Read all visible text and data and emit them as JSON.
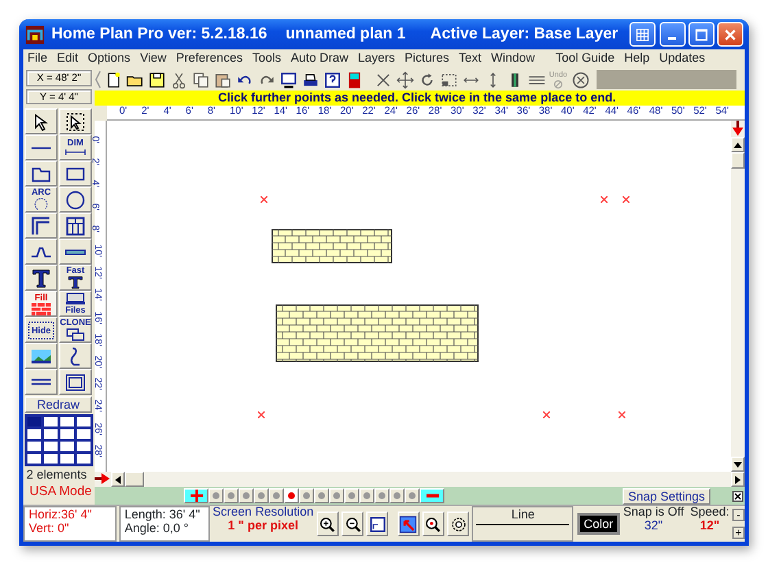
{
  "window": {
    "title": "Home Plan Pro ver: 5.2.18.16",
    "document": "unnamed plan 1",
    "layer": "Active Layer: Base Layer"
  },
  "menu": [
    "File",
    "Edit",
    "Options",
    "View",
    "Preferences",
    "Tools",
    "Auto Draw",
    "Layers",
    "Pictures",
    "Text",
    "Window",
    "Tool Guide",
    "Help",
    "Updates"
  ],
  "coordinates": {
    "x": "X = 48' 2\"",
    "y": "Y = 4' 4\""
  },
  "toolbar": [
    {
      "kind": "icon",
      "disabled": false
    },
    {
      "kind": "icon",
      "disabled": false
    },
    {
      "kind": "icon",
      "disabled": false
    },
    {
      "kind": "icon",
      "disabled": true
    },
    {
      "kind": "icon",
      "disabled": true
    },
    {
      "kind": "icon",
      "disabled": true
    },
    {
      "kind": "icon",
      "disabled": false
    },
    {
      "kind": "icon",
      "disabled": true
    },
    {
      "kind": "icon",
      "disabled": false
    },
    {
      "kind": "icon",
      "disabled": false
    },
    {
      "kind": "icon",
      "disabled": false
    },
    {
      "kind": "icon",
      "disabled": false
    },
    {
      "kind": "icon",
      "disabled": false
    },
    {
      "kind": "icon",
      "disabled": false
    },
    {
      "kind": "icon",
      "disabled": false
    },
    {
      "kind": "icon",
      "disabled": false
    },
    {
      "kind": "icon",
      "disabled": false
    },
    {
      "kind": "icon",
      "disabled": false
    },
    {
      "kind": "icon",
      "disabled": false
    },
    {
      "kind": "icon",
      "disabled": false
    },
    {
      "kind": "labeled",
      "label": "Undo",
      "disabled": true
    },
    {
      "kind": "icon",
      "disabled": false
    }
  ],
  "message": "Click further points as needed.  Click twice in the same place to end.",
  "ruler_x": [
    "0'",
    "2'",
    "4'",
    "6'",
    "8'",
    "10'",
    "12'",
    "14'",
    "16'",
    "18'",
    "20'",
    "22'",
    "24'",
    "26'",
    "28'",
    "30'",
    "32'",
    "34'",
    "36'",
    "38'",
    "40'",
    "42'",
    "44'",
    "46'",
    "48'",
    "50'",
    "52'",
    "54'"
  ],
  "ruler_y": [
    "0'",
    "2'",
    "4'",
    "6'",
    "8'",
    "10'",
    "12'",
    "14'",
    "16'",
    "18'",
    "20'",
    "22'",
    "24'",
    "26'",
    "28'"
  ],
  "tools": [
    {
      "kind": "icon"
    },
    {
      "kind": "icon"
    },
    {
      "kind": "icon"
    },
    {
      "kind": "labeled",
      "label": "DIM"
    },
    {
      "kind": "icon"
    },
    {
      "kind": "icon"
    },
    {
      "kind": "labeled",
      "label": "ARC"
    },
    {
      "kind": "icon"
    },
    {
      "kind": "icon"
    },
    {
      "kind": "icon"
    },
    {
      "kind": "icon"
    },
    {
      "kind": "icon"
    },
    {
      "kind": "icon"
    },
    {
      "kind": "labeled",
      "label": "Fast"
    },
    {
      "kind": "labeled",
      "label": "Fill"
    },
    {
      "kind": "labeled",
      "label": "Files"
    },
    {
      "kind": "labeled",
      "label": "Hide"
    },
    {
      "kind": "labeled",
      "label": "CLONE"
    },
    {
      "kind": "icon"
    },
    {
      "kind": "icon"
    },
    {
      "kind": "icon"
    },
    {
      "kind": "icon"
    }
  ],
  "redraw": "Redraw",
  "grid_cells": [
    {
      "selected": true
    },
    {
      "selected": false
    },
    {
      "selected": false
    },
    {
      "selected": false
    },
    {
      "selected": false
    },
    {
      "selected": false
    },
    {
      "selected": false
    },
    {
      "selected": false
    },
    {
      "selected": false
    },
    {
      "selected": false
    },
    {
      "selected": false
    },
    {
      "selected": false
    },
    {
      "selected": false
    },
    {
      "selected": false
    },
    {
      "selected": false
    },
    {
      "selected": false
    }
  ],
  "element_count": "2 elements",
  "mode": "USA Mode",
  "layer_buttons": [
    {
      "selected": false
    },
    {
      "selected": false
    },
    {
      "selected": false
    },
    {
      "selected": false
    },
    {
      "selected": false
    },
    {
      "selected": true
    },
    {
      "selected": false
    },
    {
      "selected": false
    },
    {
      "selected": false
    },
    {
      "selected": false
    },
    {
      "selected": false
    },
    {
      "selected": false
    },
    {
      "selected": false
    },
    {
      "selected": false
    }
  ],
  "snap_settings": "Snap Settings",
  "status": {
    "horiz": "Horiz:36' 4\"",
    "vert": "Vert:  0\"",
    "length": "Length: 36' 4\"",
    "angle": "Angle:  0,0 °",
    "resolution_title": "Screen Resolution",
    "resolution": "1 \" per pixel",
    "line": "Line",
    "color_button": "Color",
    "snap": "Snap is Off",
    "snap_value": "32\"",
    "speed": "Speed:",
    "speed_value": "12\"",
    "speed_down": "-",
    "speed_up": "+"
  }
}
